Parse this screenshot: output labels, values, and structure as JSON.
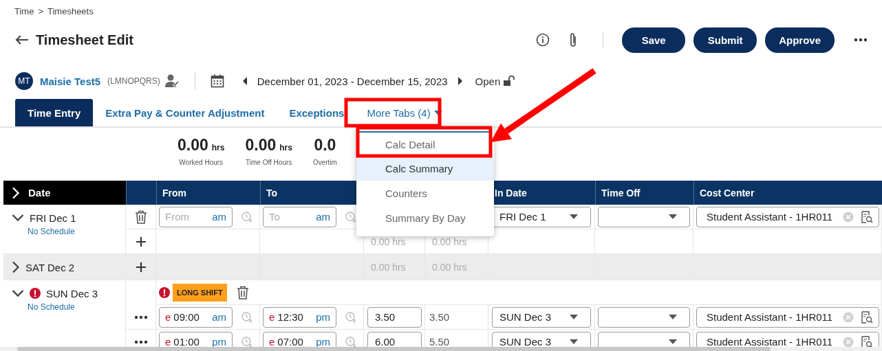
{
  "breadcrumb": {
    "items": [
      "Time",
      "Timesheets"
    ],
    "separator": ">"
  },
  "header": {
    "title": "Timesheet Edit",
    "buttons": [
      "Save",
      "Submit",
      "Approve"
    ]
  },
  "employee": {
    "initials": "MT",
    "name": "Maisie Test5",
    "code": "(LMNOPQRS)",
    "period": "December 01, 2023 - December 15, 2023",
    "status": "Open"
  },
  "tabs": [
    {
      "label": "Time Entry",
      "selected": true,
      "kind": "tab"
    },
    {
      "label": "Extra Pay & Counter Adjustment",
      "selected": false,
      "kind": "tab"
    },
    {
      "label": "Exceptions",
      "selected": false,
      "kind": "tab"
    },
    {
      "label": "More Tabs (4)",
      "selected": false,
      "kind": "dropdown"
    }
  ],
  "menu": {
    "items": [
      {
        "label": "Calc Detail",
        "selected": false
      },
      {
        "label": "Calc Summary",
        "selected": true
      },
      {
        "label": "Counters",
        "selected": false
      },
      {
        "label": "Summary By Day",
        "selected": false
      }
    ]
  },
  "summary": [
    {
      "value": "0.00",
      "unit": "hrs",
      "label": "Worked Hours"
    },
    {
      "value": "0.00",
      "unit": "hrs",
      "label": "Time Off Hours"
    },
    {
      "value": "0.0",
      "label": "Overtim"
    }
  ],
  "table": {
    "columns": [
      "Date",
      "From",
      "To",
      "In Date",
      "Time Off",
      "Cost Center"
    ],
    "days": [
      {
        "label": "FRI Dec 1",
        "expanded": true,
        "alert": false,
        "schedule": "No Schedule",
        "rows": [
          {
            "kind": "entry",
            "has_menu": false,
            "from": {
              "placeholder": "From",
              "meridiem": "am"
            },
            "to": {
              "placeholder": "To",
              "meridiem": "am"
            },
            "in_date": "FRI Dec 1",
            "cost_center": "Student Assistant - 1HR011"
          },
          {
            "kind": "totals",
            "hours": "0.00 hrs",
            "paid": "0.00 hrs"
          }
        ]
      },
      {
        "label": "SAT Dec 2",
        "expanded": false,
        "alert": false,
        "rows": [
          {
            "kind": "totals",
            "hours": "0.00 hrs",
            "paid": "0.00 hrs"
          }
        ]
      },
      {
        "label": "SUN Dec 3",
        "expanded": true,
        "alert": true,
        "schedule": "No Schedule",
        "rows": [
          {
            "kind": "flag",
            "badge": "LONG SHIFT"
          },
          {
            "kind": "entry",
            "has_menu": true,
            "from": {
              "prefix": "e",
              "value": "09:00",
              "meridiem": "am"
            },
            "to": {
              "prefix": "e",
              "value": "12:30",
              "meridiem": "pm"
            },
            "hours": "3.50",
            "paid": "3.50",
            "in_date": "SUN Dec 3",
            "cost_center": "Student Assistant - 1HR011"
          },
          {
            "kind": "entry",
            "has_menu": true,
            "from": {
              "prefix": "e",
              "value": "01:00",
              "meridiem": "pm"
            },
            "to": {
              "prefix": "e",
              "value": "07:00",
              "meridiem": "pm"
            },
            "hours": "6.00",
            "paid": "5.50",
            "in_date": "SUN Dec 3",
            "cost_center": "Student Assistant - 1HR011"
          }
        ]
      }
    ]
  }
}
